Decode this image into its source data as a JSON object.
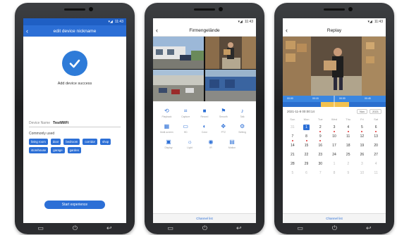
{
  "phone1": {
    "status_time": "11:43",
    "title": "edit device nickname",
    "success_text": "Add device success",
    "device_name_label": "Device Name",
    "device_name_value": "TestWiFi",
    "commonly_used_label": "Commonly used",
    "tags": [
      "living room",
      "door",
      "bedroom",
      "corridor",
      "shop",
      "storehouse",
      "garage",
      "garden"
    ],
    "start_button": "Start experience"
  },
  "phone2": {
    "status_time": "11:43",
    "title": "Firmengelände",
    "controls_row1": [
      "Playback",
      "Capture",
      "Record",
      "Smooth",
      "Talk"
    ],
    "controls_row2": [
      "Multi-screen",
      "HD",
      "Color",
      "PTZ",
      "Setting"
    ],
    "controls_row3": [
      "Display",
      "Light",
      "IR",
      "Motion"
    ],
    "channel_list": "Channel list"
  },
  "phone3": {
    "status_time": "11:43",
    "title": "Replay",
    "timeline_labels": [
      "00:00",
      "00:15",
      "00:30",
      "00:45"
    ],
    "date_text": "2021-11-8 00:00:14",
    "month_select": "Nov",
    "year_select": "2021",
    "weekdays": [
      "Sun",
      "Mon",
      "Tue",
      "Wed",
      "Thu",
      "Fri",
      "Sat"
    ],
    "weeks": [
      [
        "31",
        "1",
        "2",
        "3",
        "4",
        "5",
        "6"
      ],
      [
        "7",
        "8",
        "9",
        "10",
        "11",
        "12",
        "13"
      ],
      [
        "14",
        "15",
        "16",
        "17",
        "18",
        "19",
        "20"
      ],
      [
        "21",
        "22",
        "23",
        "24",
        "25",
        "26",
        "27"
      ],
      [
        "28",
        "29",
        "30",
        "1",
        "2",
        "3",
        "4"
      ],
      [
        "5",
        "6",
        "7",
        "8",
        "9",
        "10",
        "11"
      ]
    ],
    "channel_list": "Channel list"
  },
  "colors": {
    "brand_blue": "#2c6fd6",
    "record_dot": "#e03131"
  },
  "icons": [
    "back-arrow-icon",
    "check-icon",
    "home-icon",
    "power-icon",
    "back-icon"
  ]
}
